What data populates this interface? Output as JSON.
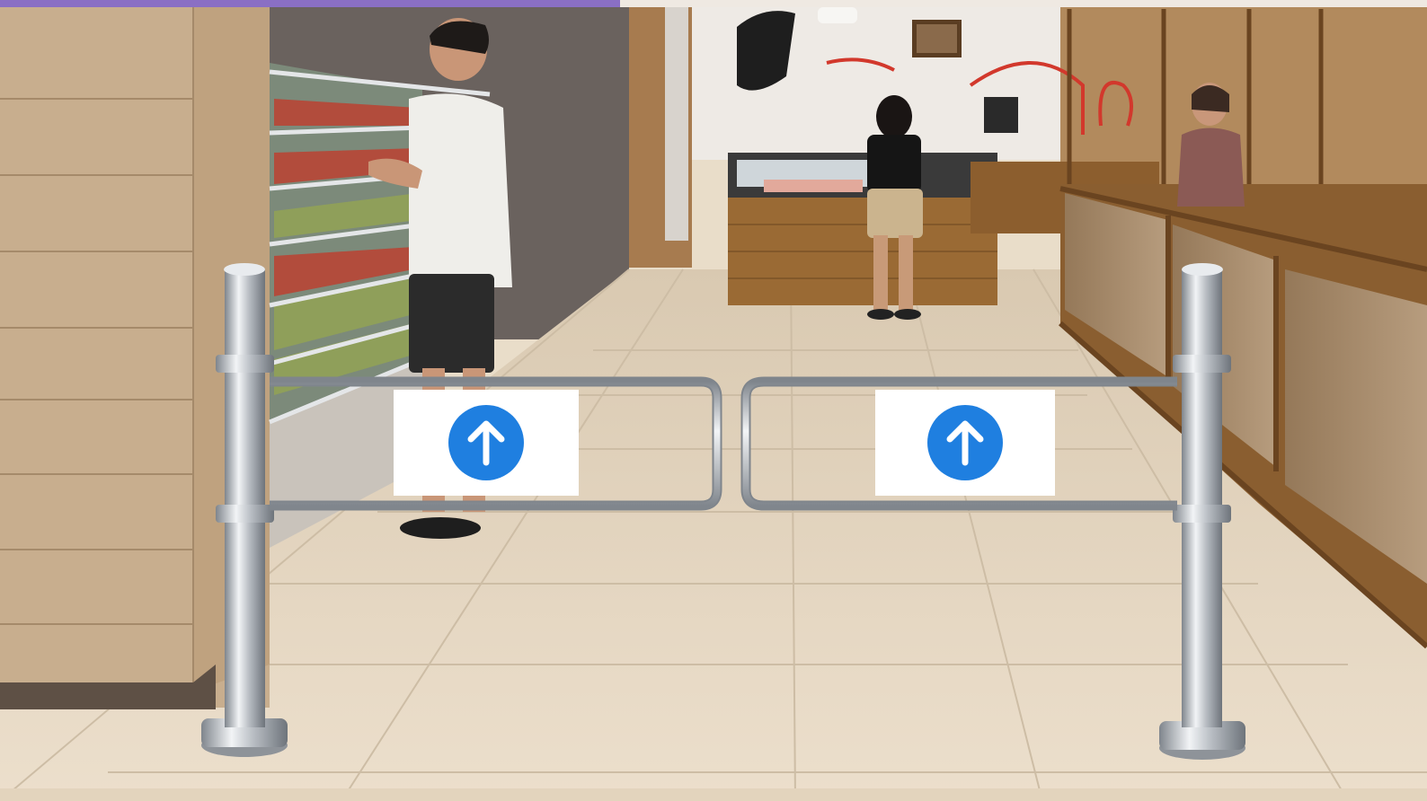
{
  "scene": {
    "description_tags": [
      "supermarket",
      "swing gate",
      "turnstile",
      "entrance"
    ],
    "colors": {
      "floor": "#e8d9c3",
      "floor_grout": "#cdbda5",
      "wall_tile": "#c8ae8e",
      "back_wall": "#6a625e",
      "steel": "#c9ccd1",
      "steel_dark": "#8e9399",
      "arrow_blue": "#1f7fe0",
      "top_band": "#8a6fc4"
    }
  },
  "gates": [
    {
      "id": "left-gate",
      "arrow_icon": "arrow-up-icon",
      "arrow_direction": "up"
    },
    {
      "id": "right-gate",
      "arrow_icon": "arrow-up-icon",
      "arrow_direction": "up"
    }
  ]
}
